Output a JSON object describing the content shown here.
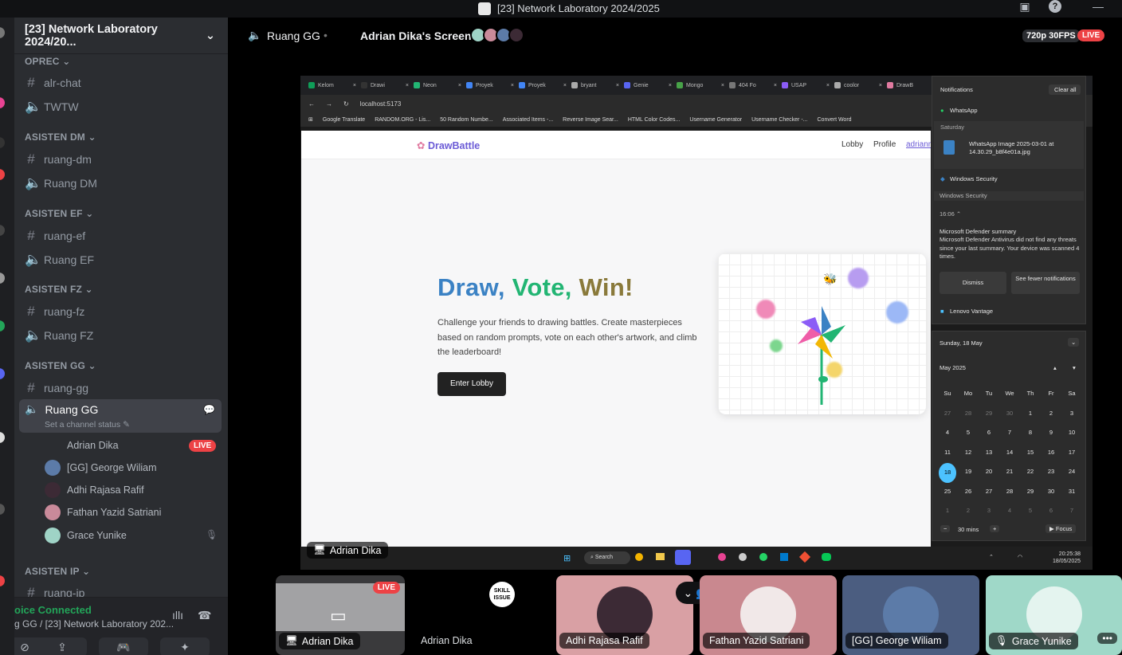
{
  "window": {
    "title": "[23] Network Laboratory 2024/2025"
  },
  "sidebar": {
    "server_name": "[23] Network Laboratory 2024/20...",
    "categories": [
      {
        "name": "OPREC",
        "channels": [
          {
            "type": "text",
            "name": "alr-chat"
          },
          {
            "type": "voice",
            "name": "TWTW"
          }
        ]
      },
      {
        "name": "ASISTEN DM",
        "channels": [
          {
            "type": "text",
            "name": "ruang-dm"
          },
          {
            "type": "voice",
            "name": "Ruang DM"
          }
        ]
      },
      {
        "name": "ASISTEN EF",
        "channels": [
          {
            "type": "text",
            "name": "ruang-ef"
          },
          {
            "type": "voice",
            "name": "Ruang EF"
          }
        ]
      },
      {
        "name": "ASISTEN FZ",
        "channels": [
          {
            "type": "text",
            "name": "ruang-fz"
          },
          {
            "type": "voice",
            "name": "Ruang FZ"
          }
        ]
      },
      {
        "name": "ASISTEN GG",
        "channels": [
          {
            "type": "text",
            "name": "ruang-gg"
          }
        ]
      },
      {
        "name": "ASISTEN IP",
        "channels": [
          {
            "type": "text",
            "name": "ruang-ip"
          }
        ]
      }
    ],
    "active_channel": {
      "name": "Ruang GG",
      "status": "Set a channel status"
    },
    "voice_users": [
      {
        "name": "Adrian Dika",
        "badge": "LIVE"
      },
      {
        "name": "[GG] George Wiliam"
      },
      {
        "name": "Adhi Rajasa Rafif"
      },
      {
        "name": "Fathan Yazid Satriani"
      },
      {
        "name": "Grace Yunike"
      }
    ],
    "voice_status": {
      "title": "oice Connected",
      "subtitle": "g GG / [23] Network Laboratory 202..."
    }
  },
  "header": {
    "channel": "Ruang GG",
    "stream_title": "Adrian Dika's Screen",
    "quality": "720p 30FPS",
    "live": "LIVE"
  },
  "browser": {
    "tabs": [
      "Kelom",
      "Drawi",
      "Neon",
      "Proyek",
      "Proyek",
      "bryant",
      "Genie",
      "Mongo",
      "404 Fo",
      "USAP",
      "coolor",
      "DrawB"
    ],
    "address": "localhost:5173",
    "bookmarks": [
      "Google Translate",
      "RANDOM.ORG - Lis...",
      "50 Random Numbe...",
      "Associated Items -...",
      "Reverse Image Sear...",
      "HTML Color Codes...",
      "Username Generator",
      "Username Checker -...",
      "Convert Word"
    ]
  },
  "site": {
    "logo": "DrawBattle",
    "nav": [
      "Lobby",
      "Profile",
      "adrianm"
    ],
    "hero_words": [
      "Draw,",
      "Vote,",
      "Win!"
    ],
    "description": "Challenge your friends to drawing battles. Create masterpieces based on random prompts, vote on each other's artwork, and climb the leaderboard!",
    "cta": "Enter Lobby"
  },
  "notifications": {
    "title": "Notifications",
    "clear": "Clear all",
    "whatsapp": "WhatsApp",
    "saturday": "Saturday",
    "wa_msg": "WhatsApp Image 2025-03-01 at 14.30.29_b8f4e01a.jpg",
    "winsec": "Windows Security",
    "winsec2": "Windows Security",
    "time": "16:06",
    "def_title": "Microsoft Defender summary",
    "def_body": "Microsoft Defender Antivirus did not find any threats since your last summary. Your device was scanned 4 times.",
    "dismiss": "Dismiss",
    "fewer": "See fewer notifications",
    "lenovo": "Lenovo Vantage"
  },
  "calendar": {
    "header": "Sunday, 18 May",
    "month": "May 2025",
    "weekdays": [
      "Su",
      "Mo",
      "Tu",
      "We",
      "Th",
      "Fr",
      "Sa"
    ],
    "days": [
      "27",
      "28",
      "29",
      "30",
      "1",
      "2",
      "3",
      "4",
      "5",
      "6",
      "7",
      "8",
      "9",
      "10",
      "11",
      "12",
      "13",
      "14",
      "15",
      "16",
      "17",
      "18",
      "19",
      "20",
      "21",
      "22",
      "23",
      "24",
      "25",
      "26",
      "27",
      "28",
      "29",
      "30",
      "31",
      "1",
      "2",
      "3",
      "4",
      "5",
      "6",
      "7"
    ],
    "today": "18",
    "focus_mins": "30 mins",
    "focus": "Focus"
  },
  "taskbar": {
    "search": "Search",
    "time": "20:25:38",
    "date": "18/05/2025"
  },
  "stream_tag": "Adrian Dika",
  "tiles": [
    {
      "name": "Adrian Dika",
      "badge": "LIVE"
    },
    {
      "name": "Adrian Dika",
      "sticker": "SKILL ISSUE"
    },
    {
      "name": "Adhi Rajasa Rafif"
    },
    {
      "name": "Fathan Yazid Satriani"
    },
    {
      "name": "[GG] George Wiliam"
    },
    {
      "name": "Grace Yunike"
    }
  ],
  "colors": {
    "accent_red": "#ed4245",
    "draw_blue": "#3b82c4",
    "vote_green": "#22b573",
    "win_brown": "#8a6a3b",
    "today": "#4cc2ff"
  }
}
